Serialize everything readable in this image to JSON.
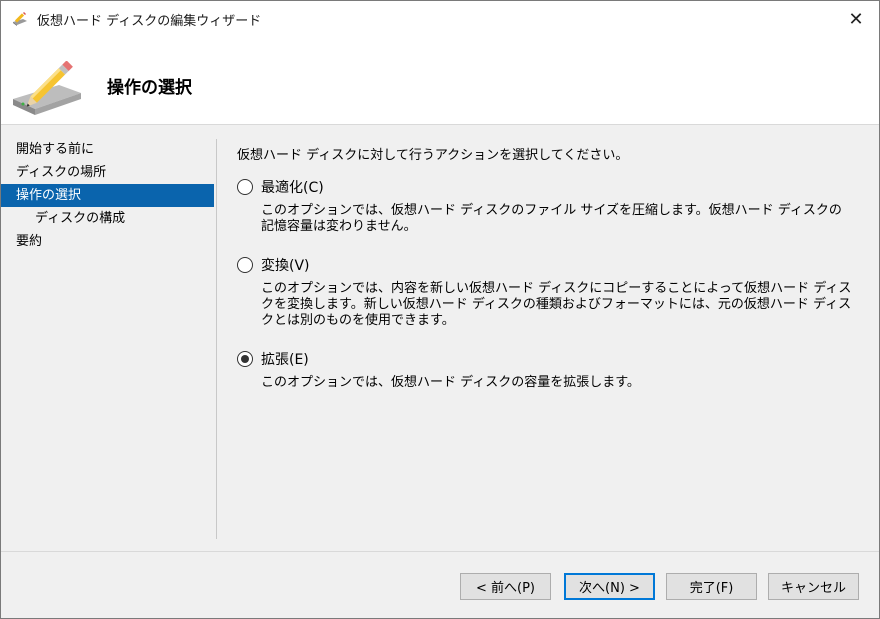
{
  "window": {
    "title": "仮想ハード ディスクの編集ウィザード",
    "close_glyph": "✕"
  },
  "header": {
    "heading": "操作の選択",
    "icon": "disk-pencil-icon"
  },
  "nav": {
    "items": [
      {
        "label": "開始する前に",
        "selected": false,
        "sub": false
      },
      {
        "label": "ディスクの場所",
        "selected": false,
        "sub": false
      },
      {
        "label": "操作の選択",
        "selected": true,
        "sub": false
      },
      {
        "label": "ディスクの構成",
        "selected": false,
        "sub": true
      },
      {
        "label": "要約",
        "selected": false,
        "sub": false
      }
    ]
  },
  "content": {
    "intro": "仮想ハード ディスクに対して行うアクションを選択してください。",
    "options": [
      {
        "label": "最適化(C)",
        "desc": "このオプションでは、仮想ハード ディスクのファイル サイズを圧縮します。仮想ハード ディスクの記憶容量は変わりません。",
        "checked": false
      },
      {
        "label": "変換(V)",
        "desc": "このオプションでは、内容を新しい仮想ハード ディスクにコピーすることによって仮想ハード ディスクを変換します。新しい仮想ハード ディスクの種類およびフォーマットには、元の仮想ハード ディスクとは別のものを使用できます。",
        "checked": false
      },
      {
        "label": "拡張(E)",
        "desc": "このオプションでは、仮想ハード ディスクの容量を拡張します。",
        "checked": true
      }
    ]
  },
  "buttons": {
    "prev": "< 前へ(P)",
    "next": "次へ(N) >",
    "finish": "完了(F)",
    "cancel": "キャンセル"
  },
  "colors": {
    "selection": "#0a64ad",
    "primary_border": "#0078d7"
  }
}
